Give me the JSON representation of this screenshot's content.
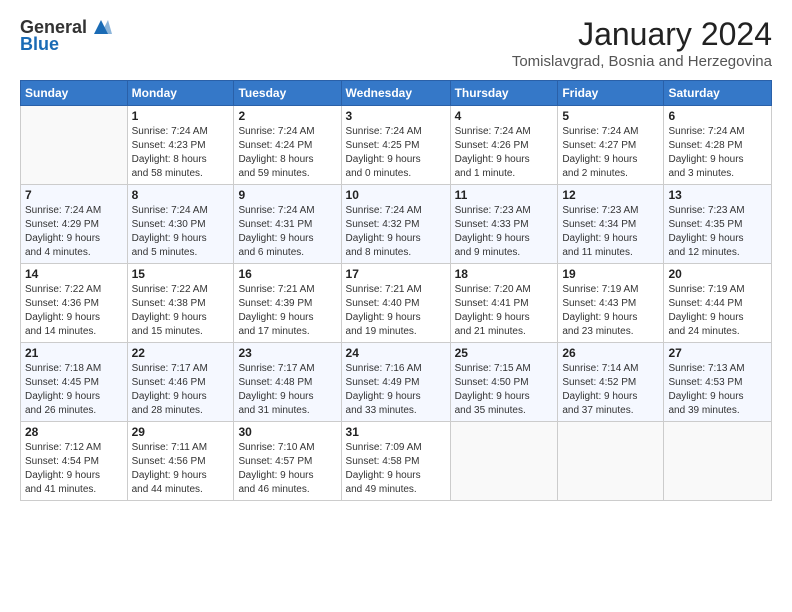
{
  "logo": {
    "line1": "General",
    "line2": "Blue"
  },
  "header": {
    "title": "January 2024",
    "subtitle": "Tomislavgrad, Bosnia and Herzegovina"
  },
  "weekdays": [
    "Sunday",
    "Monday",
    "Tuesday",
    "Wednesday",
    "Thursday",
    "Friday",
    "Saturday"
  ],
  "weeks": [
    [
      {
        "day": null,
        "info": null
      },
      {
        "day": "1",
        "info": "Sunrise: 7:24 AM\nSunset: 4:23 PM\nDaylight: 8 hours\nand 58 minutes."
      },
      {
        "day": "2",
        "info": "Sunrise: 7:24 AM\nSunset: 4:24 PM\nDaylight: 8 hours\nand 59 minutes."
      },
      {
        "day": "3",
        "info": "Sunrise: 7:24 AM\nSunset: 4:25 PM\nDaylight: 9 hours\nand 0 minutes."
      },
      {
        "day": "4",
        "info": "Sunrise: 7:24 AM\nSunset: 4:26 PM\nDaylight: 9 hours\nand 1 minute."
      },
      {
        "day": "5",
        "info": "Sunrise: 7:24 AM\nSunset: 4:27 PM\nDaylight: 9 hours\nand 2 minutes."
      },
      {
        "day": "6",
        "info": "Sunrise: 7:24 AM\nSunset: 4:28 PM\nDaylight: 9 hours\nand 3 minutes."
      }
    ],
    [
      {
        "day": "7",
        "info": "Sunrise: 7:24 AM\nSunset: 4:29 PM\nDaylight: 9 hours\nand 4 minutes."
      },
      {
        "day": "8",
        "info": "Sunrise: 7:24 AM\nSunset: 4:30 PM\nDaylight: 9 hours\nand 5 minutes."
      },
      {
        "day": "9",
        "info": "Sunrise: 7:24 AM\nSunset: 4:31 PM\nDaylight: 9 hours\nand 6 minutes."
      },
      {
        "day": "10",
        "info": "Sunrise: 7:24 AM\nSunset: 4:32 PM\nDaylight: 9 hours\nand 8 minutes."
      },
      {
        "day": "11",
        "info": "Sunrise: 7:23 AM\nSunset: 4:33 PM\nDaylight: 9 hours\nand 9 minutes."
      },
      {
        "day": "12",
        "info": "Sunrise: 7:23 AM\nSunset: 4:34 PM\nDaylight: 9 hours\nand 11 minutes."
      },
      {
        "day": "13",
        "info": "Sunrise: 7:23 AM\nSunset: 4:35 PM\nDaylight: 9 hours\nand 12 minutes."
      }
    ],
    [
      {
        "day": "14",
        "info": "Sunrise: 7:22 AM\nSunset: 4:36 PM\nDaylight: 9 hours\nand 14 minutes."
      },
      {
        "day": "15",
        "info": "Sunrise: 7:22 AM\nSunset: 4:38 PM\nDaylight: 9 hours\nand 15 minutes."
      },
      {
        "day": "16",
        "info": "Sunrise: 7:21 AM\nSunset: 4:39 PM\nDaylight: 9 hours\nand 17 minutes."
      },
      {
        "day": "17",
        "info": "Sunrise: 7:21 AM\nSunset: 4:40 PM\nDaylight: 9 hours\nand 19 minutes."
      },
      {
        "day": "18",
        "info": "Sunrise: 7:20 AM\nSunset: 4:41 PM\nDaylight: 9 hours\nand 21 minutes."
      },
      {
        "day": "19",
        "info": "Sunrise: 7:19 AM\nSunset: 4:43 PM\nDaylight: 9 hours\nand 23 minutes."
      },
      {
        "day": "20",
        "info": "Sunrise: 7:19 AM\nSunset: 4:44 PM\nDaylight: 9 hours\nand 24 minutes."
      }
    ],
    [
      {
        "day": "21",
        "info": "Sunrise: 7:18 AM\nSunset: 4:45 PM\nDaylight: 9 hours\nand 26 minutes."
      },
      {
        "day": "22",
        "info": "Sunrise: 7:17 AM\nSunset: 4:46 PM\nDaylight: 9 hours\nand 28 minutes."
      },
      {
        "day": "23",
        "info": "Sunrise: 7:17 AM\nSunset: 4:48 PM\nDaylight: 9 hours\nand 31 minutes."
      },
      {
        "day": "24",
        "info": "Sunrise: 7:16 AM\nSunset: 4:49 PM\nDaylight: 9 hours\nand 33 minutes."
      },
      {
        "day": "25",
        "info": "Sunrise: 7:15 AM\nSunset: 4:50 PM\nDaylight: 9 hours\nand 35 minutes."
      },
      {
        "day": "26",
        "info": "Sunrise: 7:14 AM\nSunset: 4:52 PM\nDaylight: 9 hours\nand 37 minutes."
      },
      {
        "day": "27",
        "info": "Sunrise: 7:13 AM\nSunset: 4:53 PM\nDaylight: 9 hours\nand 39 minutes."
      }
    ],
    [
      {
        "day": "28",
        "info": "Sunrise: 7:12 AM\nSunset: 4:54 PM\nDaylight: 9 hours\nand 41 minutes."
      },
      {
        "day": "29",
        "info": "Sunrise: 7:11 AM\nSunset: 4:56 PM\nDaylight: 9 hours\nand 44 minutes."
      },
      {
        "day": "30",
        "info": "Sunrise: 7:10 AM\nSunset: 4:57 PM\nDaylight: 9 hours\nand 46 minutes."
      },
      {
        "day": "31",
        "info": "Sunrise: 7:09 AM\nSunset: 4:58 PM\nDaylight: 9 hours\nand 49 minutes."
      },
      {
        "day": null,
        "info": null
      },
      {
        "day": null,
        "info": null
      },
      {
        "day": null,
        "info": null
      }
    ]
  ]
}
